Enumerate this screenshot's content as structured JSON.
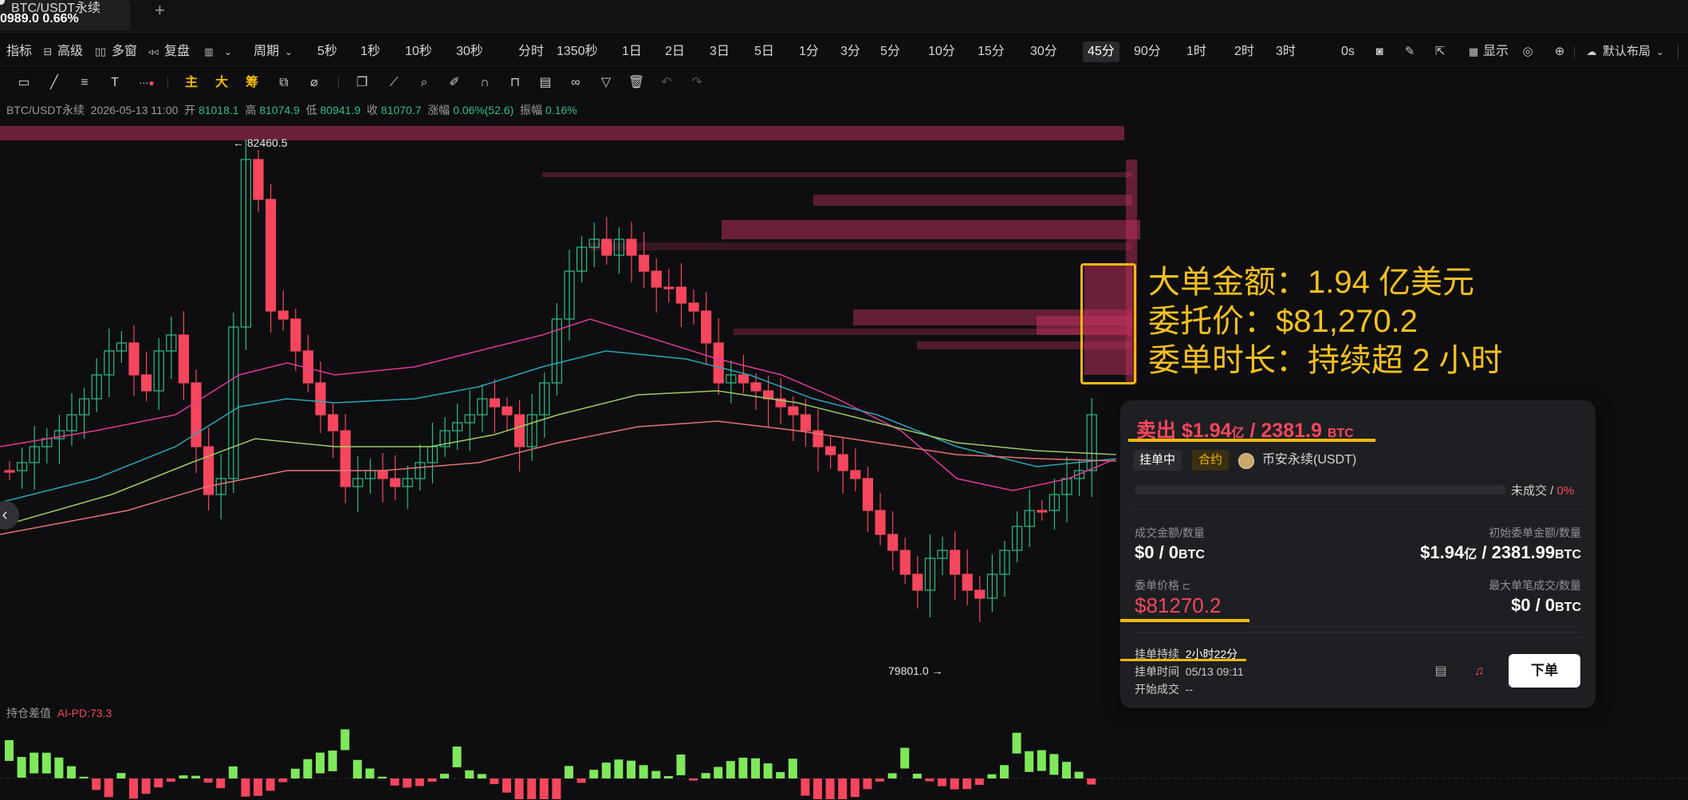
{
  "tab": {
    "title": "BTC/USDT永续",
    "price_change": "0989.0  0.66%",
    "add": "+"
  },
  "toolbar": {
    "indicators": "指标",
    "advanced": "高级",
    "multi_window": "多窗",
    "replay": "复盘",
    "period": "周期",
    "intervals": [
      "5秒",
      "1秒",
      "10秒",
      "30秒",
      "分时",
      "1350秒",
      "1日",
      "2日",
      "3日",
      "5日",
      "1分",
      "3分",
      "5分",
      "10分",
      "15分",
      "30分",
      "45分",
      "90分",
      "1时",
      "2时",
      "3时"
    ],
    "active_interval": "45分",
    "countdown": "0s",
    "display": "显示",
    "layout": "默认布局"
  },
  "drawtools": {
    "main": "主",
    "big": "大",
    "chip": "筹"
  },
  "ohlc": {
    "symbol": "BTC/USDT永续",
    "time": "2026-05-13 11:00",
    "open_label": "开",
    "open": "81018.1",
    "high_label": "高",
    "high": "81074.9",
    "low_label": "低",
    "low": "80941.9",
    "close_label": "收",
    "close": "81070.7",
    "change_label": "涨幅",
    "change": "0.06%(52.6)",
    "amplitude_label": "振幅",
    "amplitude": "0.16%"
  },
  "chart": {
    "high_marker": "← 82460.5",
    "low_marker": "79801.0 →",
    "colors": {
      "up": "#2ebd85",
      "down": "#f6465d",
      "bg": "#0e0e10"
    }
  },
  "annotation": {
    "lines": [
      "大单金额：1.94 亿美元",
      "委托价：$81,270.2",
      "委单时长：持续超 2 小时"
    ],
    "color": "#f5c020"
  },
  "order_card": {
    "side_label": "卖出",
    "amount": "$1.94",
    "amount_unit": "亿",
    "qty": " / 2381.9",
    "qty_unit": "BTC",
    "status": "挂单中",
    "type": "合约",
    "market": "币安永续(USDT)",
    "fill_progress": 0,
    "unfilled_label": "未成交 / ",
    "unfilled_pct": "0%",
    "filled_label": "成交金额/数量",
    "filled_value": "$0 / 0",
    "filled_unit": "BTC",
    "initial_label": "初始委单金额/数量",
    "initial_value": "$1.94",
    "initial_unit1": "亿",
    "initial_value2": " / 2381.99",
    "initial_unit2": "BTC",
    "price_label": "委单价格",
    "price": "$81270.2",
    "max_fill_label": "最大单笔成交/数量",
    "max_fill_value": "$0 / 0",
    "max_fill_unit": "BTC",
    "duration_label": "挂单持续",
    "duration": "2小时22分",
    "time_label": "挂单时间",
    "time": "05/13 09:11",
    "start_label": "开始成交",
    "start": "--",
    "order_button": "下单"
  },
  "indicator": {
    "name": "持仓差值",
    "value": "AI-PD:73.3"
  }
}
